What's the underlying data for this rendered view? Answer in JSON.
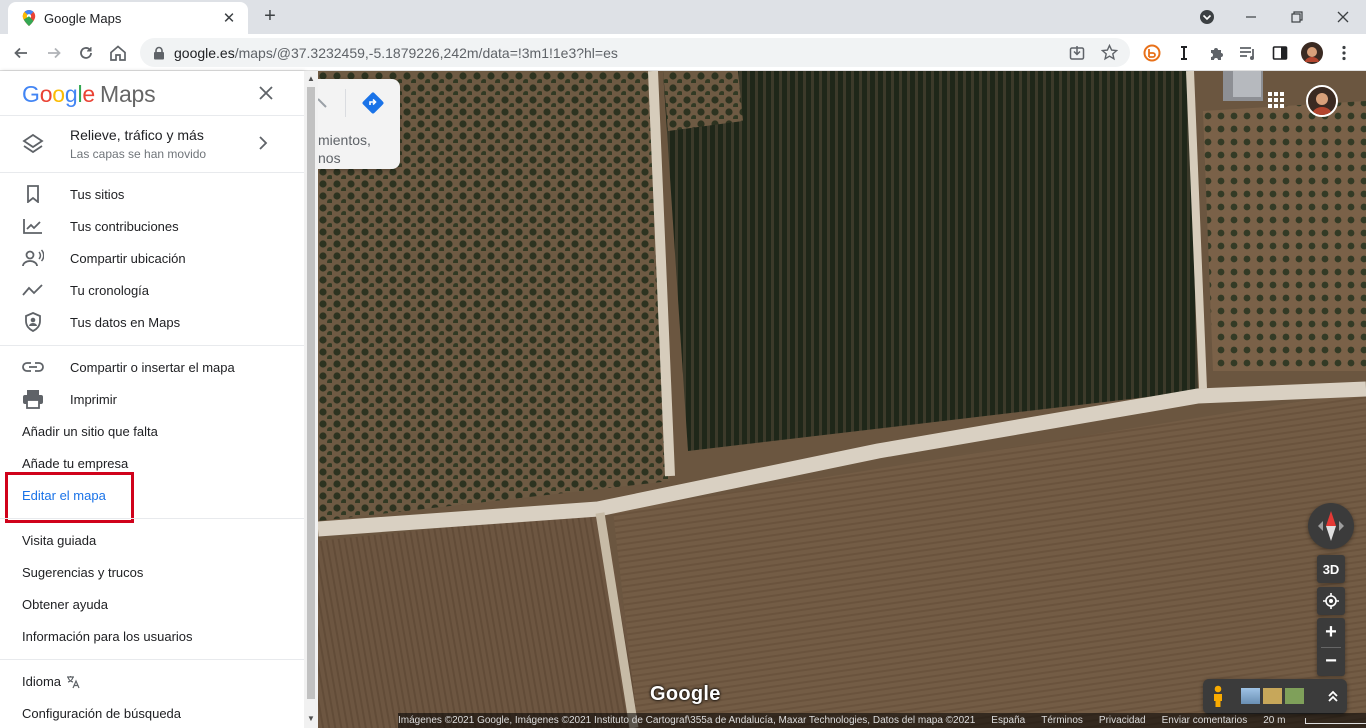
{
  "browser": {
    "tab_title": "Google Maps",
    "url_host": "google.es",
    "url_path": "/maps/@37.3232459,-5.1879226,242m/data=!3m1!1e3?hl=es"
  },
  "menu": {
    "logo_google": "Google",
    "logo_maps": "Maps",
    "layers_title": "Relieve, tráfico y más",
    "layers_subtitle": "Las capas se han movido",
    "group1": [
      {
        "label": "Tus sitios",
        "icon": "bookmark-icon"
      },
      {
        "label": "Tus contribuciones",
        "icon": "contributions-icon"
      },
      {
        "label": "Compartir ubicación",
        "icon": "share-location-icon"
      },
      {
        "label": "Tu cronología",
        "icon": "timeline-icon"
      },
      {
        "label": "Tus datos en Maps",
        "icon": "shield-user-icon"
      }
    ],
    "group2": [
      {
        "label": "Compartir o insertar el mapa",
        "icon": "link-icon"
      },
      {
        "label": "Imprimir",
        "icon": "print-icon"
      },
      {
        "label": "Añadir un sitio que falta"
      },
      {
        "label": "Añade tu empresa"
      },
      {
        "label": "Editar el mapa"
      }
    ],
    "group3": [
      {
        "label": "Visita guiada"
      },
      {
        "label": "Sugerencias y trucos"
      },
      {
        "label": "Obtener ayuda"
      },
      {
        "label": "Información para los usuarios"
      }
    ],
    "group4": [
      {
        "label": "Idioma",
        "icon": "translate-icon"
      },
      {
        "label": "Configuración de búsqueda"
      }
    ],
    "highlight_color": "#d0021b",
    "active_link_color": "#1a73e8"
  },
  "map": {
    "search_fragment_line1": "mientos,",
    "search_fragment_line2": "nos",
    "button_3d": "3D",
    "zoom_in": "+",
    "zoom_out": "−",
    "logo": "Google",
    "attribution": "Imágenes ©2021 Google, Imágenes ©2021 Instituto de Cartograf\\355a de Andalucía, Maxar Technologies, Datos del mapa ©2021",
    "links": [
      "España",
      "Términos",
      "Privacidad",
      "Enviar comentarios"
    ],
    "scale": "20 m"
  }
}
